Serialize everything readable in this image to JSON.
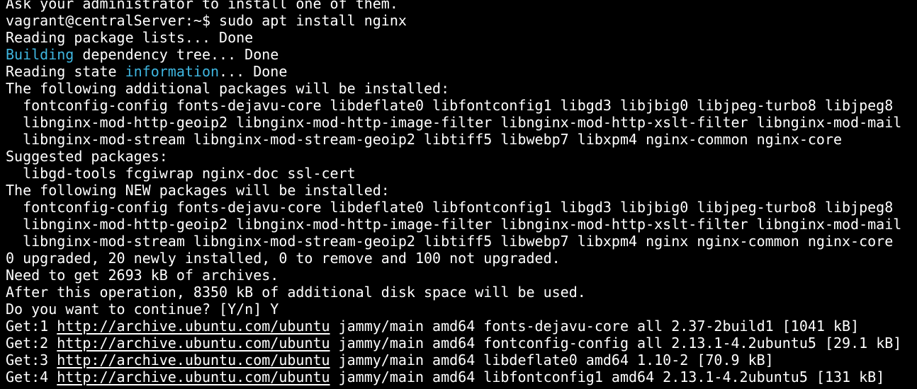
{
  "colors": {
    "background": "#000000",
    "foreground": "#ffffff",
    "highlight": "#3fb6e0"
  },
  "terminal": {
    "lines": [
      [
        {
          "t": "Ask your administrator to install one of them.",
          "s": "default"
        }
      ],
      [
        {
          "t": "vagrant@centralServer:~$ sudo apt install nginx",
          "s": "default"
        }
      ],
      [
        {
          "t": "Reading package lists... Done",
          "s": "default"
        }
      ],
      [
        {
          "t": "Building",
          "s": "cyan"
        },
        {
          "t": " dependency tree... Done",
          "s": "default"
        }
      ],
      [
        {
          "t": "Reading state ",
          "s": "default"
        },
        {
          "t": "information",
          "s": "cyan"
        },
        {
          "t": "... Done",
          "s": "default"
        }
      ],
      [
        {
          "t": "The following additional packages will be installed:",
          "s": "default"
        }
      ],
      [
        {
          "t": "  fontconfig-config fonts-dejavu-core libdeflate0 libfontconfig1 libgd3 libjbig0 libjpeg-turbo8 libjpeg8",
          "s": "default"
        }
      ],
      [
        {
          "t": "  libnginx-mod-http-geoip2 libnginx-mod-http-image-filter libnginx-mod-http-xslt-filter libnginx-mod-mail",
          "s": "default"
        }
      ],
      [
        {
          "t": "  libnginx-mod-stream libnginx-mod-stream-geoip2 libtiff5 libwebp7 libxpm4 nginx-common nginx-core",
          "s": "default"
        }
      ],
      [
        {
          "t": "Suggested packages:",
          "s": "default"
        }
      ],
      [
        {
          "t": "  libgd-tools fcgiwrap nginx-doc ssl-cert",
          "s": "default"
        }
      ],
      [
        {
          "t": "The following NEW packages will be installed:",
          "s": "default"
        }
      ],
      [
        {
          "t": "  fontconfig-config fonts-dejavu-core libdeflate0 libfontconfig1 libgd3 libjbig0 libjpeg-turbo8 libjpeg8",
          "s": "default"
        }
      ],
      [
        {
          "t": "  libnginx-mod-http-geoip2 libnginx-mod-http-image-filter libnginx-mod-http-xslt-filter libnginx-mod-mail",
          "s": "default"
        }
      ],
      [
        {
          "t": "  libnginx-mod-stream libnginx-mod-stream-geoip2 libtiff5 libwebp7 libxpm4 nginx nginx-common nginx-core",
          "s": "default"
        }
      ],
      [
        {
          "t": "0 upgraded, 20 newly installed, 0 to remove and 100 not upgraded.",
          "s": "default"
        }
      ],
      [
        {
          "t": "Need to get 2693 kB of archives.",
          "s": "default"
        }
      ],
      [
        {
          "t": "After this operation, 8350 kB of additional disk space will be used.",
          "s": "default"
        }
      ],
      [
        {
          "t": "Do you want to continue? [Y/n] Y",
          "s": "default"
        }
      ],
      [
        {
          "t": "Get:1 ",
          "s": "default"
        },
        {
          "t": "http://archive.ubuntu.com/ubuntu",
          "s": "link"
        },
        {
          "t": " jammy/main amd64 fonts-dejavu-core all 2.37-2build1 [1041 kB]",
          "s": "default"
        }
      ],
      [
        {
          "t": "Get:2 ",
          "s": "default"
        },
        {
          "t": "http://archive.ubuntu.com/ubuntu",
          "s": "link"
        },
        {
          "t": " jammy/main amd64 fontconfig-config all 2.13.1-4.2ubuntu5 [29.1 kB]",
          "s": "default"
        }
      ],
      [
        {
          "t": "Get:3 ",
          "s": "default"
        },
        {
          "t": "http://archive.ubuntu.com/ubuntu",
          "s": "link"
        },
        {
          "t": " jammy/main amd64 libdeflate0 amd64 1.10-2 [70.9 kB]",
          "s": "default"
        }
      ],
      [
        {
          "t": "Get:4 ",
          "s": "default"
        },
        {
          "t": "http://archive.ubuntu.com/ubuntu",
          "s": "link"
        },
        {
          "t": " jammy/main amd64 libfontconfig1 amd64 2.13.1-4.2ubuntu5 [131 kB]",
          "s": "default"
        }
      ]
    ]
  }
}
